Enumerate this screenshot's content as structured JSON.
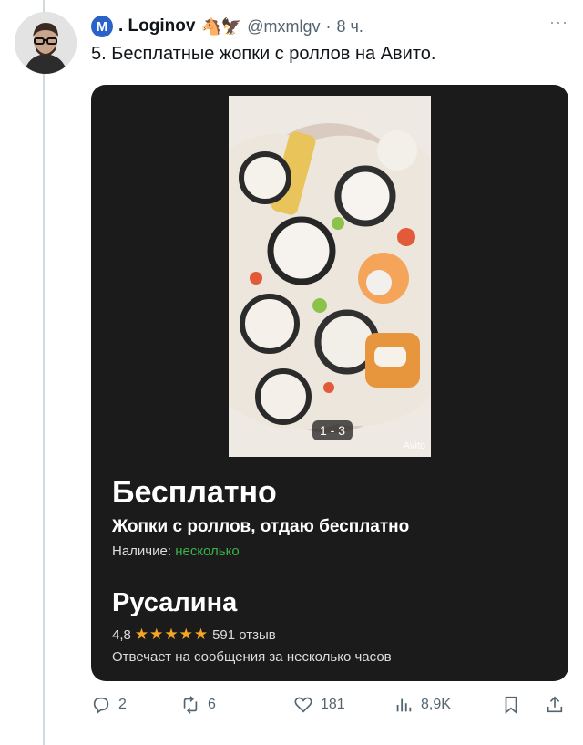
{
  "tweet": {
    "author_initial": "M",
    "author_name": ". Loginov",
    "author_emoji": "🐴🦅",
    "handle": "@mxmlgv",
    "separator": "·",
    "time": "8 ч.",
    "more_label": "···",
    "text": "5. Бесплатные жопки с роллов на Авито."
  },
  "card": {
    "image_counter": "1 - 3",
    "watermark": "Avito",
    "price": "Бесплатно",
    "title": "Жопки с роллов, отдаю бесплатно",
    "availability_label": "Наличие: ",
    "availability_value": "несколько",
    "seller_name": "Русалина",
    "rating": "4,8",
    "stars": "★★★★★",
    "reviews": "591 отзыв",
    "response_time": "Отвечает на сообщения за несколько часов"
  },
  "actions": {
    "replies": "2",
    "reposts": "6",
    "likes": "181",
    "views": "8,9K"
  },
  "colors": {
    "accent_blue": "#2a62c9",
    "card_bg": "#1b1b1b",
    "availability_green": "#39b54a",
    "star_orange": "#f5a623"
  }
}
